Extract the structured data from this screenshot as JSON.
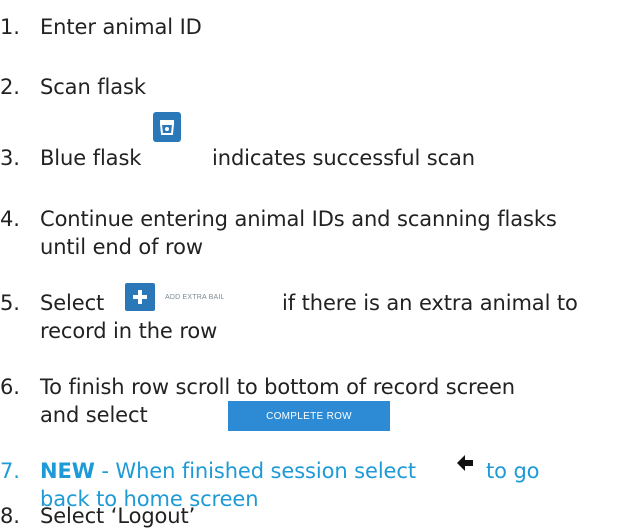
{
  "steps": [
    {
      "number": "1.",
      "text": "Enter animal ID"
    },
    {
      "number": "2.",
      "text": "Scan flask"
    },
    {
      "number": "3.",
      "text_before": "Blue flask",
      "text_after": "indicates successful scan"
    },
    {
      "number": "4.",
      "line1": "Continue entering animal IDs and scanning flasks",
      "line2": "until end of row"
    },
    {
      "number": "5.",
      "text_before": "Select",
      "text_after": "if there is an extra animal to",
      "line2": "record in the row"
    },
    {
      "number": "6.",
      "line1": "To finish row scroll to bottom of record screen",
      "line2_before": "and select"
    },
    {
      "number": "7.",
      "highlight": "NEW",
      "text_before": "- When finished session select",
      "text_after": "to go",
      "line2": "back to home screen"
    },
    {
      "number": "8.",
      "text": "Select ‘Logout’"
    }
  ],
  "ui": {
    "add_extra_bail_label": "ADD EXTRA BAIL",
    "complete_row_label": "COMPLETE ROW"
  },
  "icons": {
    "flask": "flask-icon",
    "plus": "plus-icon",
    "back": "back-arrow-icon"
  },
  "colors": {
    "text": "#222222",
    "accent": "#1e9ad6",
    "button_blue": "#2d8bd6",
    "icon_blue": "#2a78b8"
  }
}
